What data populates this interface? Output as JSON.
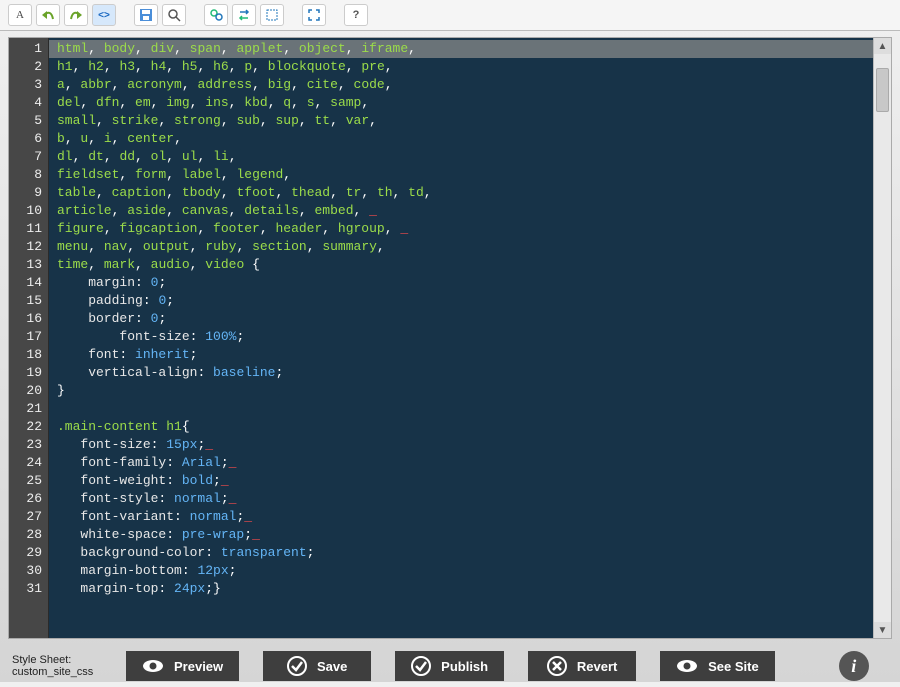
{
  "toolbar": {
    "icons": [
      {
        "name": "select-element",
        "glyph": "A"
      },
      {
        "name": "undo",
        "glyph": "↶"
      },
      {
        "name": "redo",
        "glyph": "↷"
      },
      {
        "name": "code-view",
        "glyph": "<>",
        "active": true
      },
      {
        "name": "save",
        "glyph": "💾"
      },
      {
        "name": "zoom",
        "glyph": "🔍"
      },
      {
        "name": "find",
        "glyph": "🔎"
      },
      {
        "name": "replace",
        "glyph": "⇄"
      },
      {
        "name": "select-all",
        "glyph": "▯"
      },
      {
        "name": "fullscreen",
        "glyph": "⤢"
      },
      {
        "name": "help",
        "glyph": "?"
      }
    ]
  },
  "code": {
    "lines": [
      {
        "n": 1,
        "sel": true,
        "tokens": [
          [
            "html",
            "tag"
          ],
          [
            ", ",
            "punc"
          ],
          [
            "body",
            "tag"
          ],
          [
            ", ",
            "punc"
          ],
          [
            "div",
            "tag"
          ],
          [
            ", ",
            "punc"
          ],
          [
            "span",
            "tag"
          ],
          [
            ", ",
            "punc"
          ],
          [
            "applet",
            "tag"
          ],
          [
            ", ",
            "punc"
          ],
          [
            "object",
            "tag"
          ],
          [
            ", ",
            "punc"
          ],
          [
            "iframe",
            "tag"
          ],
          [
            ",",
            "punc"
          ]
        ]
      },
      {
        "n": 2,
        "tokens": [
          [
            "h1",
            "tag"
          ],
          [
            ", ",
            "punc"
          ],
          [
            "h2",
            "tag"
          ],
          [
            ", ",
            "punc"
          ],
          [
            "h3",
            "tag"
          ],
          [
            ", ",
            "punc"
          ],
          [
            "h4",
            "tag"
          ],
          [
            ", ",
            "punc"
          ],
          [
            "h5",
            "tag"
          ],
          [
            ", ",
            "punc"
          ],
          [
            "h6",
            "tag"
          ],
          [
            ", ",
            "punc"
          ],
          [
            "p",
            "tag"
          ],
          [
            ", ",
            "punc"
          ],
          [
            "blockquote",
            "tag"
          ],
          [
            ", ",
            "punc"
          ],
          [
            "pre",
            "tag"
          ],
          [
            ",",
            "punc"
          ]
        ]
      },
      {
        "n": 3,
        "tokens": [
          [
            "a",
            "tag"
          ],
          [
            ", ",
            "punc"
          ],
          [
            "abbr",
            "tag"
          ],
          [
            ", ",
            "punc"
          ],
          [
            "acronym",
            "tag"
          ],
          [
            ", ",
            "punc"
          ],
          [
            "address",
            "tag"
          ],
          [
            ", ",
            "punc"
          ],
          [
            "big",
            "tag"
          ],
          [
            ", ",
            "punc"
          ],
          [
            "cite",
            "tag"
          ],
          [
            ", ",
            "punc"
          ],
          [
            "code",
            "tag"
          ],
          [
            ",",
            "punc"
          ]
        ]
      },
      {
        "n": 4,
        "tokens": [
          [
            "del",
            "tag"
          ],
          [
            ", ",
            "punc"
          ],
          [
            "dfn",
            "tag"
          ],
          [
            ", ",
            "punc"
          ],
          [
            "em",
            "tag"
          ],
          [
            ", ",
            "punc"
          ],
          [
            "img",
            "tag"
          ],
          [
            ", ",
            "punc"
          ],
          [
            "ins",
            "tag"
          ],
          [
            ", ",
            "punc"
          ],
          [
            "kbd",
            "tag"
          ],
          [
            ", ",
            "punc"
          ],
          [
            "q",
            "tag"
          ],
          [
            ", ",
            "punc"
          ],
          [
            "s",
            "tag"
          ],
          [
            ", ",
            "punc"
          ],
          [
            "samp",
            "tag"
          ],
          [
            ",",
            "punc"
          ]
        ]
      },
      {
        "n": 5,
        "tokens": [
          [
            "small",
            "tag"
          ],
          [
            ", ",
            "punc"
          ],
          [
            "strike",
            "tag"
          ],
          [
            ", ",
            "punc"
          ],
          [
            "strong",
            "tag"
          ],
          [
            ", ",
            "punc"
          ],
          [
            "sub",
            "tag"
          ],
          [
            ", ",
            "punc"
          ],
          [
            "sup",
            "tag"
          ],
          [
            ", ",
            "punc"
          ],
          [
            "tt",
            "tag"
          ],
          [
            ", ",
            "punc"
          ],
          [
            "var",
            "tag"
          ],
          [
            ",",
            "punc"
          ]
        ]
      },
      {
        "n": 6,
        "tokens": [
          [
            "b",
            "tag"
          ],
          [
            ", ",
            "punc"
          ],
          [
            "u",
            "tag"
          ],
          [
            ", ",
            "punc"
          ],
          [
            "i",
            "tag"
          ],
          [
            ", ",
            "punc"
          ],
          [
            "center",
            "tag"
          ],
          [
            ",",
            "punc"
          ]
        ]
      },
      {
        "n": 7,
        "tokens": [
          [
            "dl",
            "tag"
          ],
          [
            ", ",
            "punc"
          ],
          [
            "dt",
            "tag"
          ],
          [
            ", ",
            "punc"
          ],
          [
            "dd",
            "tag"
          ],
          [
            ", ",
            "punc"
          ],
          [
            "ol",
            "tag"
          ],
          [
            ", ",
            "punc"
          ],
          [
            "ul",
            "tag"
          ],
          [
            ", ",
            "punc"
          ],
          [
            "li",
            "tag"
          ],
          [
            ",",
            "punc"
          ]
        ]
      },
      {
        "n": 8,
        "tokens": [
          [
            "fieldset",
            "tag"
          ],
          [
            ", ",
            "punc"
          ],
          [
            "form",
            "tag"
          ],
          [
            ", ",
            "punc"
          ],
          [
            "label",
            "tag"
          ],
          [
            ", ",
            "punc"
          ],
          [
            "legend",
            "tag"
          ],
          [
            ",",
            "punc"
          ]
        ]
      },
      {
        "n": 9,
        "tokens": [
          [
            "table",
            "tag"
          ],
          [
            ", ",
            "punc"
          ],
          [
            "caption",
            "tag"
          ],
          [
            ", ",
            "punc"
          ],
          [
            "tbody",
            "tag"
          ],
          [
            ", ",
            "punc"
          ],
          [
            "tfoot",
            "tag"
          ],
          [
            ", ",
            "punc"
          ],
          [
            "thead",
            "tag"
          ],
          [
            ", ",
            "punc"
          ],
          [
            "tr",
            "tag"
          ],
          [
            ", ",
            "punc"
          ],
          [
            "th",
            "tag"
          ],
          [
            ", ",
            "punc"
          ],
          [
            "td",
            "tag"
          ],
          [
            ",",
            "punc"
          ]
        ]
      },
      {
        "n": 10,
        "tokens": [
          [
            "article",
            "tag"
          ],
          [
            ", ",
            "punc"
          ],
          [
            "aside",
            "tag"
          ],
          [
            ", ",
            "punc"
          ],
          [
            "canvas",
            "tag"
          ],
          [
            ", ",
            "punc"
          ],
          [
            "details",
            "tag"
          ],
          [
            ", ",
            "punc"
          ],
          [
            "embed",
            "tag"
          ],
          [
            ",",
            "punc"
          ],
          [
            " _",
            "err"
          ]
        ]
      },
      {
        "n": 11,
        "tokens": [
          [
            "figure",
            "tag"
          ],
          [
            ", ",
            "punc"
          ],
          [
            "figcaption",
            "tag"
          ],
          [
            ", ",
            "punc"
          ],
          [
            "footer",
            "tag"
          ],
          [
            ", ",
            "punc"
          ],
          [
            "header",
            "tag"
          ],
          [
            ", ",
            "punc"
          ],
          [
            "hgroup",
            "tag"
          ],
          [
            ",",
            "punc"
          ],
          [
            " _",
            "err"
          ]
        ]
      },
      {
        "n": 12,
        "tokens": [
          [
            "menu",
            "tag"
          ],
          [
            ", ",
            "punc"
          ],
          [
            "nav",
            "tag"
          ],
          [
            ", ",
            "punc"
          ],
          [
            "output",
            "tag"
          ],
          [
            ", ",
            "punc"
          ],
          [
            "ruby",
            "tag"
          ],
          [
            ", ",
            "punc"
          ],
          [
            "section",
            "tag"
          ],
          [
            ", ",
            "punc"
          ],
          [
            "summary",
            "tag"
          ],
          [
            ",",
            "punc"
          ]
        ]
      },
      {
        "n": 13,
        "tokens": [
          [
            "time",
            "tag"
          ],
          [
            ", ",
            "punc"
          ],
          [
            "mark",
            "tag"
          ],
          [
            ", ",
            "punc"
          ],
          [
            "audio",
            "tag"
          ],
          [
            ", ",
            "punc"
          ],
          [
            "video",
            "tag"
          ],
          [
            " {",
            "punc"
          ]
        ]
      },
      {
        "n": 14,
        "tokens": [
          [
            "    margin",
            "prop"
          ],
          [
            ": ",
            "punc"
          ],
          [
            "0",
            "val"
          ],
          [
            ";",
            "punc"
          ]
        ]
      },
      {
        "n": 15,
        "tokens": [
          [
            "    padding",
            "prop"
          ],
          [
            ": ",
            "punc"
          ],
          [
            "0",
            "val"
          ],
          [
            ";",
            "punc"
          ]
        ]
      },
      {
        "n": 16,
        "tokens": [
          [
            "    border",
            "prop"
          ],
          [
            ": ",
            "punc"
          ],
          [
            "0",
            "val"
          ],
          [
            ";",
            "punc"
          ]
        ]
      },
      {
        "n": 17,
        "tokens": [
          [
            "        font-size",
            "prop"
          ],
          [
            ": ",
            "punc"
          ],
          [
            "100%",
            "val"
          ],
          [
            ";",
            "punc"
          ]
        ]
      },
      {
        "n": 18,
        "tokens": [
          [
            "    font",
            "prop"
          ],
          [
            ": ",
            "punc"
          ],
          [
            "inherit",
            "val"
          ],
          [
            ";",
            "punc"
          ]
        ]
      },
      {
        "n": 19,
        "tokens": [
          [
            "    vertical-align",
            "prop"
          ],
          [
            ": ",
            "punc"
          ],
          [
            "baseline",
            "val"
          ],
          [
            ";",
            "punc"
          ]
        ]
      },
      {
        "n": 20,
        "tokens": [
          [
            "}",
            "punc"
          ]
        ]
      },
      {
        "n": 21,
        "tokens": [
          [
            " ",
            "text"
          ]
        ]
      },
      {
        "n": 22,
        "tokens": [
          [
            ".main-content ",
            "tag"
          ],
          [
            "h1",
            "tag"
          ],
          [
            "{",
            "punc"
          ]
        ]
      },
      {
        "n": 23,
        "tokens": [
          [
            "   font-size",
            "prop"
          ],
          [
            ": ",
            "punc"
          ],
          [
            "15px",
            "val"
          ],
          [
            ";",
            "punc"
          ],
          [
            "_",
            "err"
          ]
        ]
      },
      {
        "n": 24,
        "tokens": [
          [
            "   font-family",
            "prop"
          ],
          [
            ": ",
            "punc"
          ],
          [
            "Arial",
            "val"
          ],
          [
            ";",
            "punc"
          ],
          [
            "_",
            "err"
          ]
        ]
      },
      {
        "n": 25,
        "tokens": [
          [
            "   font-weight",
            "prop"
          ],
          [
            ": ",
            "punc"
          ],
          [
            "bold",
            "val"
          ],
          [
            ";",
            "punc"
          ],
          [
            "_",
            "err"
          ]
        ]
      },
      {
        "n": 26,
        "tokens": [
          [
            "   font-style",
            "prop"
          ],
          [
            ": ",
            "punc"
          ],
          [
            "normal",
            "val"
          ],
          [
            ";",
            "punc"
          ],
          [
            "_",
            "err"
          ]
        ]
      },
      {
        "n": 27,
        "tokens": [
          [
            "   font-variant",
            "prop"
          ],
          [
            ": ",
            "punc"
          ],
          [
            "normal",
            "val"
          ],
          [
            ";",
            "punc"
          ],
          [
            "_",
            "err"
          ]
        ]
      },
      {
        "n": 28,
        "tokens": [
          [
            "   white-space",
            "prop"
          ],
          [
            ": ",
            "punc"
          ],
          [
            "pre-wrap",
            "val"
          ],
          [
            ";",
            "punc"
          ],
          [
            "_",
            "err"
          ]
        ]
      },
      {
        "n": 29,
        "tokens": [
          [
            "   background-color",
            "prop"
          ],
          [
            ": ",
            "punc"
          ],
          [
            "transparent",
            "val"
          ],
          [
            ";",
            "punc"
          ]
        ]
      },
      {
        "n": 30,
        "tokens": [
          [
            "   margin-bottom",
            "prop"
          ],
          [
            ": ",
            "punc"
          ],
          [
            "12px",
            "val"
          ],
          [
            ";",
            "punc"
          ]
        ]
      },
      {
        "n": 31,
        "tokens": [
          [
            "   margin-top",
            "prop"
          ],
          [
            ": ",
            "punc"
          ],
          [
            "24px",
            "val"
          ],
          [
            ";}",
            "punc"
          ]
        ]
      }
    ]
  },
  "stylesheet": {
    "label": "Style Sheet:",
    "name": "custom_site_css"
  },
  "buttons": {
    "preview": "Preview",
    "save": "Save",
    "publish": "Publish",
    "revert": "Revert",
    "seesite": "See Site"
  }
}
